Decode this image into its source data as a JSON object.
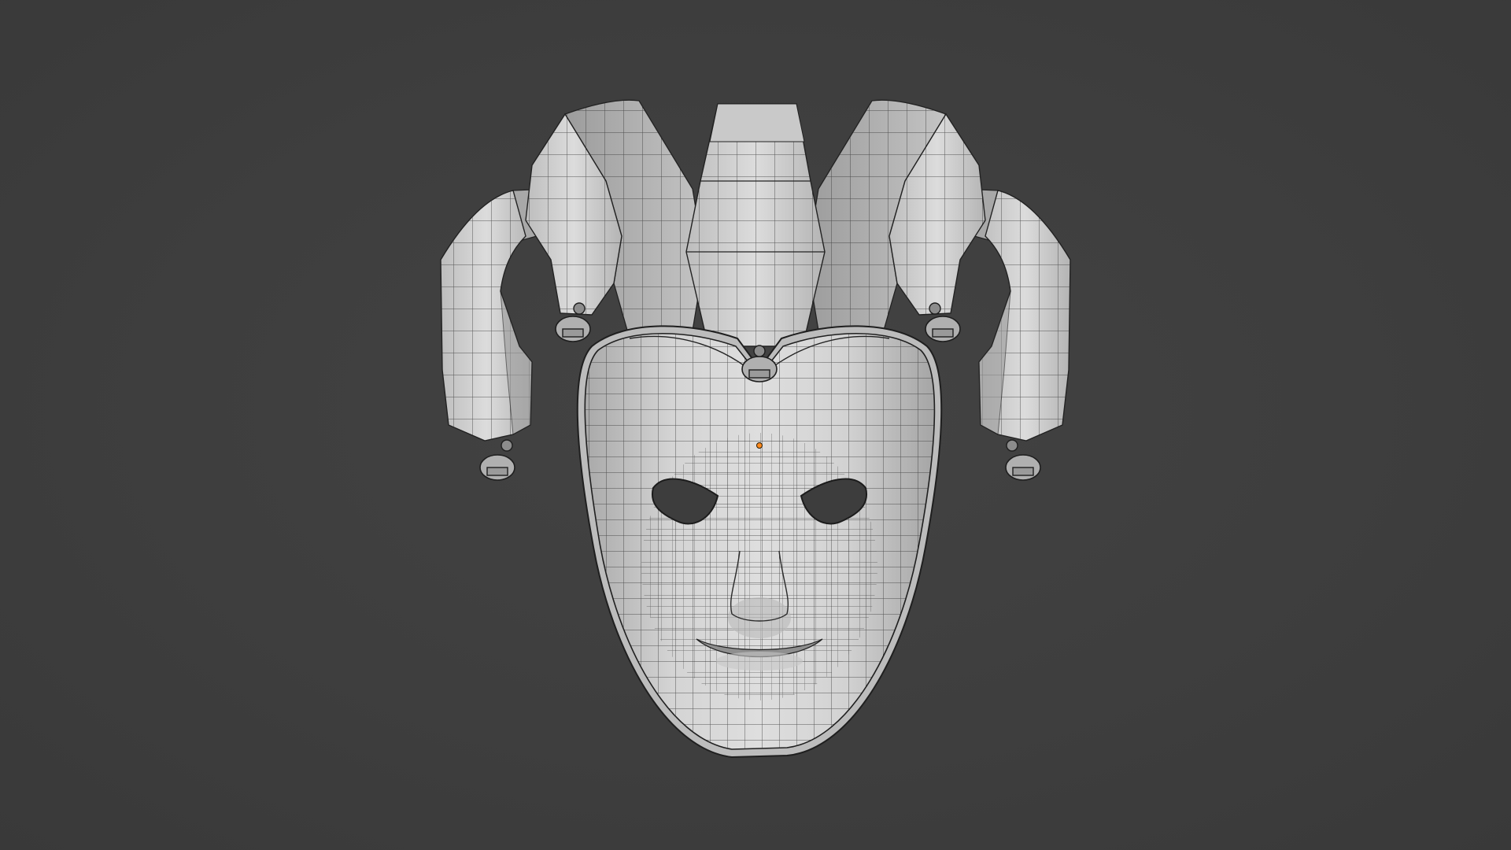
{
  "viewport": {
    "background_color": "#3d3d3d",
    "shading": "solid-wireframe",
    "mesh_color": "#d6d6d6",
    "wire_color": "#2a2a2a",
    "origin_marker_color": "#ff8a1e"
  },
  "object": {
    "semantic": "jester-mask-mesh",
    "parts": [
      "face-mask",
      "center-horn",
      "left-inner-horn",
      "right-inner-horn",
      "left-outer-horn",
      "right-outer-horn",
      "bells"
    ],
    "bell_count": 5
  }
}
